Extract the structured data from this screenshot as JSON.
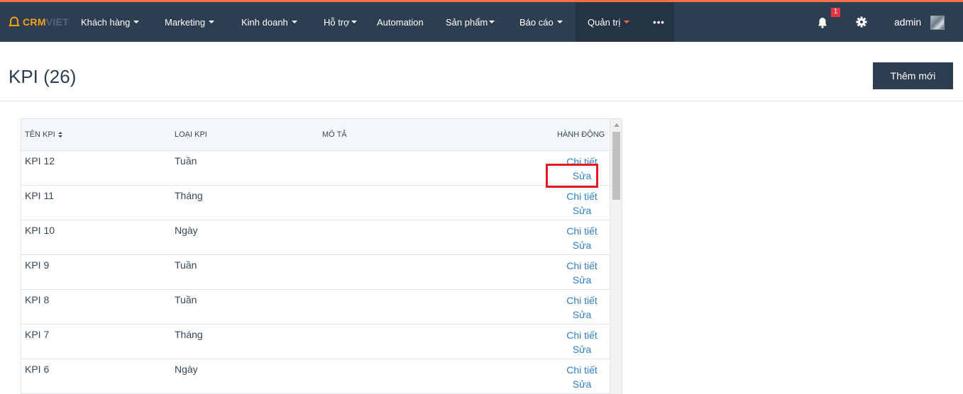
{
  "brand": {
    "logo_crm": "CRM",
    "logo_viet": "VIET"
  },
  "nav": {
    "items": [
      {
        "label": "Khách hàng",
        "caret": true
      },
      {
        "label": "Marketing",
        "caret": true
      },
      {
        "label": "Kinh doanh",
        "caret": true
      },
      {
        "label": "Hỗ trợ",
        "caret": true
      },
      {
        "label": "Automation",
        "caret": false
      },
      {
        "label": "Sản phẩm",
        "caret": true
      },
      {
        "label": "Báo cáo",
        "caret": true
      },
      {
        "label": "Quản trị",
        "caret": true,
        "active": true
      }
    ],
    "more_label": "•••",
    "notification_count": "1",
    "user_name": "admin"
  },
  "page": {
    "title": "KPI (26)",
    "add_button": "Thêm mới"
  },
  "table": {
    "headers": [
      "TÊN KPI",
      "LOẠI KPI",
      "MÔ TẢ",
      "HÀNH ĐỘNG"
    ],
    "action_detail": "Chi tiết",
    "action_edit": "Sửa",
    "rows": [
      {
        "name": "KPI 12",
        "type": "Tuần",
        "desc": ""
      },
      {
        "name": "KPI 11",
        "type": "Tháng",
        "desc": ""
      },
      {
        "name": "KPI 10",
        "type": "Ngày",
        "desc": ""
      },
      {
        "name": "KPI 9",
        "type": "Tuần",
        "desc": ""
      },
      {
        "name": "KPI 8",
        "type": "Tuần",
        "desc": ""
      },
      {
        "name": "KPI 7",
        "type": "Tháng",
        "desc": ""
      },
      {
        "name": "KPI 6",
        "type": "Ngày",
        "desc": ""
      }
    ]
  },
  "colors": {
    "navbar": "#2d3e50",
    "accent": "#f36f45",
    "link": "#2f7fc1",
    "highlight": "#e11b22"
  }
}
